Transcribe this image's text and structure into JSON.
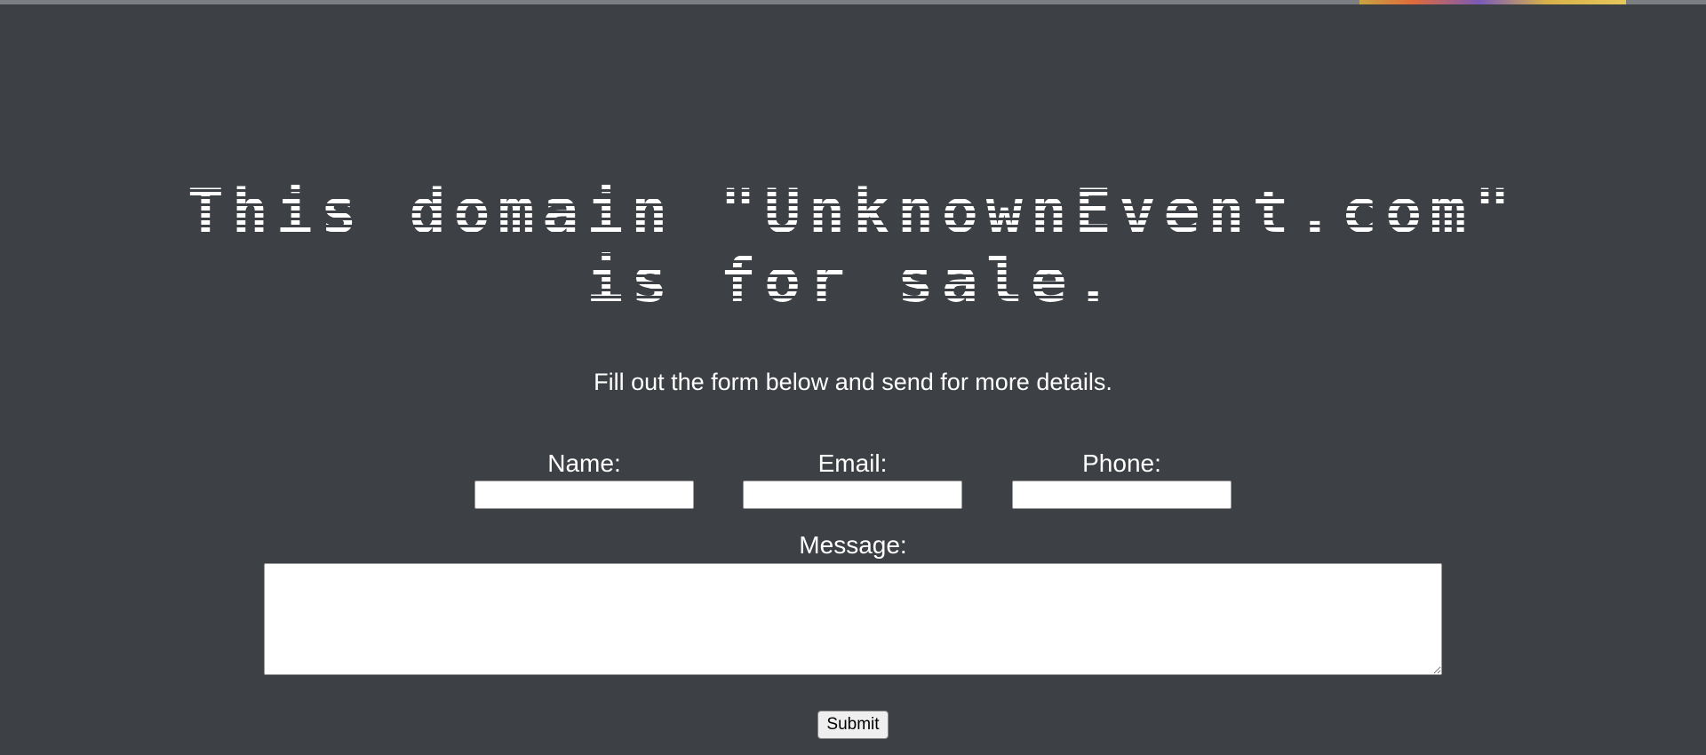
{
  "headline": {
    "line1": "This domain \"UnknownEvent.com\"",
    "line2": "is for sale."
  },
  "subtitle": "Fill out the form below and send for more details.",
  "form": {
    "name_label": "Name:",
    "name_value": "",
    "email_label": "Email:",
    "email_value": "",
    "phone_label": "Phone:",
    "phone_value": "",
    "message_label": "Message:",
    "message_value": "",
    "submit_label": "Submit"
  },
  "colors": {
    "background": "#3d4045",
    "text": "#ffffff",
    "input_background": "#ffffff"
  }
}
